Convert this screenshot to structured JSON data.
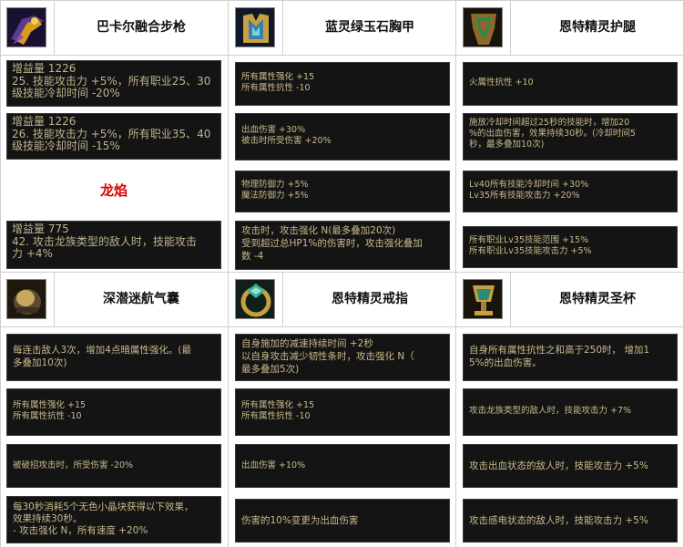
{
  "columns": [
    {
      "title": "巴卡尔融合步枪",
      "icon": "rifle-icon",
      "top": [
        {
          "lines": [
            "增益量 1226",
            "25. 技能攻击力 +5%，所有职业25、30",
            "级技能冷却时间 -20%"
          ]
        },
        {
          "lines": [
            "增益量 1226",
            "26. 技能攻击力 +5%，所有职业35、40",
            "级技能冷却时间 -15%"
          ]
        },
        {
          "label": "龙焰"
        },
        {
          "lines": [
            "增益量 775",
            "42. 攻击龙族类型的敌人时，技能攻击",
            "力 +4%"
          ]
        }
      ]
    },
    {
      "title": "蓝灵绿玉石胸甲",
      "icon": "chest-armor-icon",
      "top": [
        {
          "lines": [
            "所有属性强化 +15",
            "所有属性抗性 -10"
          ]
        },
        {
          "lines": [
            "出血伤害 +30%",
            "被击时所受伤害 +20%"
          ]
        },
        {
          "lines": [
            "物理防御力 +5%",
            "魔法防御力 +5%"
          ]
        },
        {
          "lines": [
            "攻击时，攻击强化 N(最多叠加20次)",
            "受到超过总HP1%的伤害时，攻击强化叠加",
            "数 -4"
          ]
        }
      ]
    },
    {
      "title": "恩特精灵护腿",
      "icon": "leg-armor-icon",
      "top": [
        {
          "lines": [
            "火属性抗性 +10"
          ]
        },
        {
          "lines": [
            "施放冷却时间超过25秒的技能时，增加20",
            "%的出血伤害，效果持续30秒。(冷却时间5",
            "秒，最多叠加10次)"
          ]
        },
        {
          "lines": [
            "Lv40所有技能冷却时间 +30%",
            "Lv35所有技能攻击力 +20%"
          ]
        },
        {
          "lines": [
            "所有职业Lv35技能范围 +15%",
            "所有职业Lv35技能攻击力 +5%"
          ]
        }
      ]
    }
  ],
  "columns2": [
    {
      "title": "深潜迷航气囊",
      "icon": "airbag-icon",
      "boxes": [
        {
          "lines": [
            "每连击敌人3次，增加4点暗属性强化。(最",
            "多叠加10次)"
          ]
        },
        {
          "lines": [
            "所有属性强化 +15",
            "所有属性抗性 -10"
          ]
        },
        {
          "lines": [
            "被破招攻击时，所受伤害 -20%"
          ]
        },
        {
          "lines": [
            "每30秒消耗5个无色小晶块获得以下效果，",
            "效果持续30秒。",
            "- 攻击强化 N，所有速度 +20%"
          ]
        }
      ]
    },
    {
      "title": "恩特精灵戒指",
      "icon": "ring-icon",
      "boxes": [
        {
          "lines": [
            "自身施加的减速持续时间 +2秒",
            "以自身攻击减少韧性条时，攻击强化 N（",
            "最多叠加5次)"
          ]
        },
        {
          "lines": [
            "所有属性强化 +15",
            "所有属性抗性 -10"
          ]
        },
        {
          "lines": [
            "出血伤害 +10%"
          ]
        },
        {
          "lines": [
            "伤害的10%变更为出血伤害"
          ]
        }
      ]
    },
    {
      "title": "恩特精灵圣杯",
      "icon": "chalice-icon",
      "boxes": [
        {
          "lines": [
            "自身所有属性抗性之和高于250时， 增加1",
            "5%的出血伤害。"
          ]
        },
        {
          "lines": [
            "攻击龙族类型的敌人时，技能攻击力 +7%"
          ]
        },
        {
          "lines": [
            "攻击出血状态的敌人时，技能攻击力 +5%"
          ]
        },
        {
          "lines": [
            "攻击感电状态的敌人时，技能攻击力 +5%"
          ]
        }
      ]
    }
  ]
}
